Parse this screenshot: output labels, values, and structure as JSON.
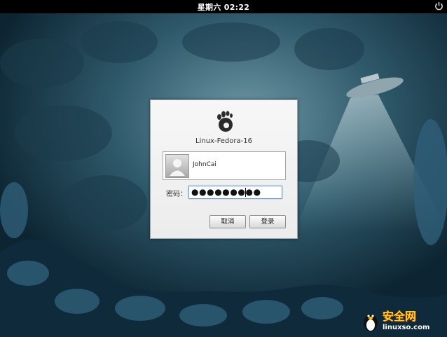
{
  "topbar": {
    "clock": "星期六 02:22",
    "power_icon": "power-icon"
  },
  "login_dialog": {
    "logo_icon": "gnome-foot-icon",
    "hostname": "Linux-Fedora-16",
    "user": {
      "avatar_icon": "user-avatar-icon",
      "name": "JohnCai"
    },
    "password": {
      "label": "密码：",
      "masked_value": "●●●●●●●●●"
    },
    "buttons": {
      "cancel": "取消",
      "login": "登录"
    }
  },
  "watermark": {
    "title": "安全网",
    "url": "linuxso.com"
  },
  "colors": {
    "topbar": "#000000",
    "dialog_bg": "#f1f1f1",
    "input_focus_border": "#6d98c6",
    "background_dark": "#0c2330"
  }
}
